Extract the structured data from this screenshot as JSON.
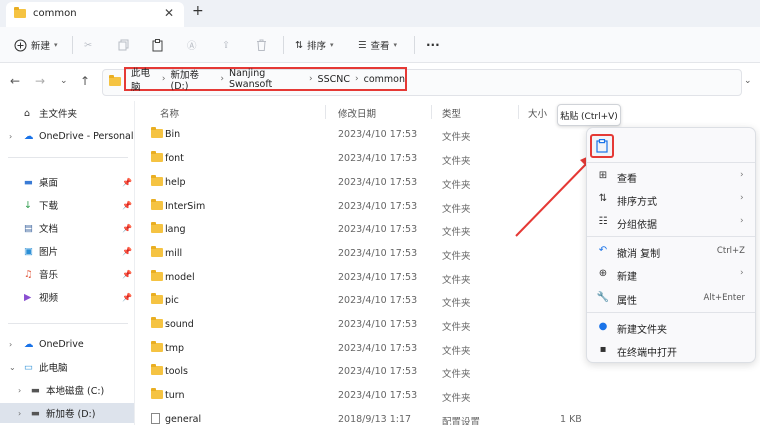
{
  "tab": {
    "title": "common",
    "close": "✕",
    "new": "+"
  },
  "toolbar": {
    "new_label": "新建",
    "sort_label": "排序",
    "view_label": "查看",
    "more": "···"
  },
  "address": {
    "crumbs": [
      "此电脑",
      "新加卷 (D:)",
      "Nanjing Swansoft",
      "SSCNC",
      "common"
    ]
  },
  "sidebar": {
    "home": "主文件夹",
    "onedrive_personal": "OneDrive - Personal",
    "quick": [
      "桌面",
      "下载",
      "文档",
      "图片",
      "音乐",
      "视频"
    ],
    "onedrive": "OneDrive",
    "thispc": "此电脑",
    "drive_c": "本地磁盘 (C:)",
    "drive_d": "新加卷 (D:)"
  },
  "columns": {
    "name": "名称",
    "date": "修改日期",
    "type": "类型",
    "size": "大小"
  },
  "files": [
    {
      "name": "Bin",
      "date": "2023/4/10 17:53",
      "type": "文件夹",
      "size": ""
    },
    {
      "name": "font",
      "date": "2023/4/10 17:53",
      "type": "文件夹",
      "size": ""
    },
    {
      "name": "help",
      "date": "2023/4/10 17:53",
      "type": "文件夹",
      "size": ""
    },
    {
      "name": "InterSim",
      "date": "2023/4/10 17:53",
      "type": "文件夹",
      "size": ""
    },
    {
      "name": "lang",
      "date": "2023/4/10 17:53",
      "type": "文件夹",
      "size": ""
    },
    {
      "name": "mill",
      "date": "2023/4/10 17:53",
      "type": "文件夹",
      "size": ""
    },
    {
      "name": "model",
      "date": "2023/4/10 17:53",
      "type": "文件夹",
      "size": ""
    },
    {
      "name": "pic",
      "date": "2023/4/10 17:53",
      "type": "文件夹",
      "size": ""
    },
    {
      "name": "sound",
      "date": "2023/4/10 17:53",
      "type": "文件夹",
      "size": ""
    },
    {
      "name": "tmp",
      "date": "2023/4/10 17:53",
      "type": "文件夹",
      "size": ""
    },
    {
      "name": "tools",
      "date": "2023/4/10 17:53",
      "type": "文件夹",
      "size": ""
    },
    {
      "name": "turn",
      "date": "2023/4/10 17:53",
      "type": "文件夹",
      "size": ""
    },
    {
      "name": "general",
      "date": "2018/9/13 1:17",
      "type": "配置设置",
      "size": "1 KB"
    }
  ],
  "tooltip": "粘贴 (Ctrl+V)",
  "menu": {
    "view": "查看",
    "sort": "排序方式",
    "group": "分组依据",
    "undo": "撤消 复制",
    "undo_key": "Ctrl+Z",
    "new": "新建",
    "props": "属性",
    "props_key": "Alt+Enter",
    "new_folder": "新建文件夹",
    "terminal": "在终端中打开"
  },
  "colors": {
    "highlight": "#e53935",
    "accent": "#1a73e8",
    "folder": "#f5c342"
  }
}
